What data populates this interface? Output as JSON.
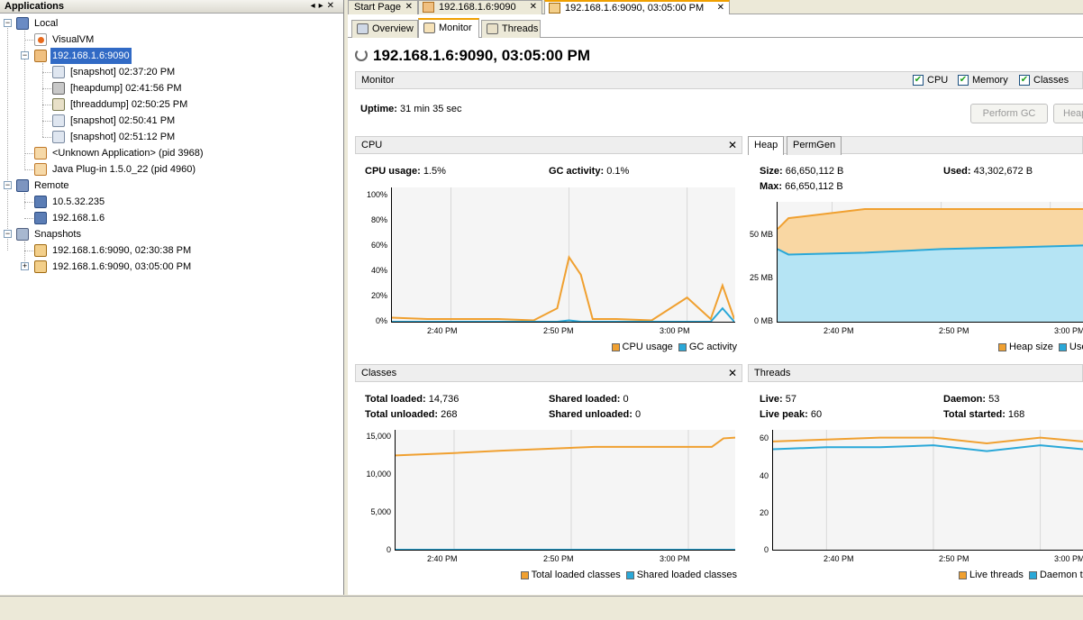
{
  "left_panel": {
    "title": "Applications"
  },
  "tree": {
    "local": "Local",
    "visualvm": "VisualVM",
    "jmx_app": "192.168.1.6:9090",
    "snap1": "[snapshot] 02:37:20 PM",
    "heap1": "[heapdump] 02:41:56 PM",
    "thread1": "[threaddump] 02:50:25 PM",
    "snap2": "[snapshot] 02:50:41 PM",
    "snap3": "[snapshot] 02:51:12 PM",
    "unknown_app": "<Unknown Application> (pid 3968)",
    "plugin_app": "Java Plug-in 1.5.0_22 (pid 4960)",
    "remote": "Remote",
    "host1": "10.5.32.235",
    "host2": "192.168.1.6",
    "snapshots": "Snapshots",
    "appsnap1": "192.168.1.6:9090, 02:30:38 PM",
    "appsnap2": "192.168.1.6:9090, 03:05:00 PM"
  },
  "doc_tabs": [
    "Start Page",
    "192.168.1.6:9090",
    "192.168.1.6:9090, 03:05:00 PM"
  ],
  "sub_tabs": [
    "Overview",
    "Monitor",
    "Threads"
  ],
  "title": "192.168.1.6:9090, 03:05:00 PM",
  "monitor_bar": {
    "label": "Monitor",
    "checks": [
      {
        "label": "CPU",
        "checked": true
      },
      {
        "label": "Memory",
        "checked": true
      },
      {
        "label": "Classes",
        "checked": true
      }
    ]
  },
  "uptime": {
    "label": "Uptime:",
    "value": "31 min 35 sec"
  },
  "buttons": {
    "perform_gc": "Perform GC",
    "heap_dump": "Heap Dump"
  },
  "cpu": {
    "title": "CPU",
    "usage_label": "CPU usage:",
    "usage_value": "1.5%",
    "gc_label": "GC activity:",
    "gc_value": "0.1%",
    "legend": [
      "CPU usage",
      "GC activity"
    ]
  },
  "heap": {
    "tab_heap": "Heap",
    "tab_permgen": "PermGen",
    "size_label": "Size:",
    "size_value": "66,650,112 B",
    "used_label": "Used:",
    "used_value": "43,302,672 B",
    "max_label": "Max:",
    "max_value": "66,650,112 B",
    "legend": [
      "Heap size",
      "Used heap"
    ]
  },
  "classes": {
    "title": "Classes",
    "total_loaded_label": "Total loaded:",
    "total_loaded_value": "14,736",
    "shared_loaded_label": "Shared loaded:",
    "shared_loaded_value": "0",
    "total_unloaded_label": "Total unloaded:",
    "total_unloaded_value": "268",
    "shared_unloaded_label": "Shared unloaded:",
    "shared_unloaded_value": "0",
    "legend": [
      "Total loaded classes",
      "Shared loaded classes"
    ]
  },
  "threads": {
    "title": "Threads",
    "live_label": "Live:",
    "live_value": "57",
    "daemon_label": "Daemon:",
    "daemon_value": "53",
    "peak_label": "Live peak:",
    "peak_value": "60",
    "started_label": "Total started:",
    "started_value": "168",
    "legend": [
      "Live threads",
      "Daemon threads"
    ]
  },
  "colors": {
    "orange": "#f0a030",
    "blue": "#2aa8d8",
    "select": "#316ac5"
  },
  "chart_data": [
    {
      "type": "line",
      "title": "CPU",
      "x": [
        "2:35 PM",
        "2:38 PM",
        "2:41 PM",
        "2:44 PM",
        "2:47 PM",
        "2:49 PM",
        "2:50 PM",
        "2:51 PM",
        "2:52 PM",
        "2:54 PM",
        "2:57 PM",
        "3:00 PM",
        "3:02 PM",
        "3:03 PM",
        "3:04 PM"
      ],
      "xticks": [
        "2:40 PM",
        "2:50 PM",
        "3:00 PM"
      ],
      "yticks": [
        "0%",
        "20%",
        "40%",
        "60%",
        "80%",
        "100%"
      ],
      "ylim": [
        0,
        100
      ],
      "series": [
        {
          "name": "CPU usage",
          "values": [
            3,
            2,
            2,
            2,
            1,
            10,
            48,
            35,
            2,
            2,
            1,
            18,
            2,
            27,
            2
          ]
        },
        {
          "name": "GC activity",
          "values": [
            0,
            0,
            0,
            0,
            0,
            0,
            1,
            0,
            0,
            0,
            0,
            0,
            0,
            10,
            0
          ]
        }
      ]
    },
    {
      "type": "area",
      "title": "Heap",
      "x": [
        "2:35 PM",
        "2:36 PM",
        "2:43 PM",
        "2:50 PM",
        "2:57 PM",
        "3:03 PM"
      ],
      "xticks": [
        "2:40 PM",
        "2:50 PM",
        "3:00 PM"
      ],
      "yticks": [
        "0 MB",
        "25 MB",
        "50 MB"
      ],
      "ylim": [
        0,
        66
      ],
      "series": [
        {
          "name": "Heap size",
          "values": [
            51,
            57,
            62,
            62,
            62,
            62
          ]
        },
        {
          "name": "Used heap",
          "values": [
            40,
            37,
            38,
            40,
            41,
            42
          ]
        }
      ]
    },
    {
      "type": "line",
      "title": "Classes",
      "x": [
        "2:35 PM",
        "2:40 PM",
        "2:44 PM",
        "2:52 PM",
        "3:02 PM",
        "3:03 PM",
        "3:04 PM"
      ],
      "xticks": [
        "2:40 PM",
        "2:50 PM",
        "3:00 PM"
      ],
      "yticks": [
        "0",
        "5,000",
        "10,000",
        "15,000"
      ],
      "ylim": [
        0,
        15500
      ],
      "series": [
        {
          "name": "Total loaded classes",
          "values": [
            12200,
            12500,
            12800,
            13300,
            13300,
            14400,
            14500
          ]
        },
        {
          "name": "Shared loaded classes",
          "values": [
            0,
            0,
            0,
            0,
            0,
            0,
            0
          ]
        }
      ]
    },
    {
      "type": "line",
      "title": "Threads",
      "x": [
        "2:35 PM",
        "2:40 PM",
        "2:45 PM",
        "2:50 PM",
        "2:55 PM",
        "3:00 PM",
        "3:04 PM"
      ],
      "xticks": [
        "2:40 PM",
        "2:50 PM",
        "3:00 PM"
      ],
      "yticks": [
        "0",
        "20",
        "40",
        "60"
      ],
      "ylim": [
        0,
        62
      ],
      "series": [
        {
          "name": "Live threads",
          "values": [
            56,
            57,
            58,
            58,
            55,
            58,
            56
          ]
        },
        {
          "name": "Daemon threads",
          "values": [
            52,
            53,
            53,
            54,
            51,
            54,
            52
          ]
        }
      ]
    }
  ]
}
